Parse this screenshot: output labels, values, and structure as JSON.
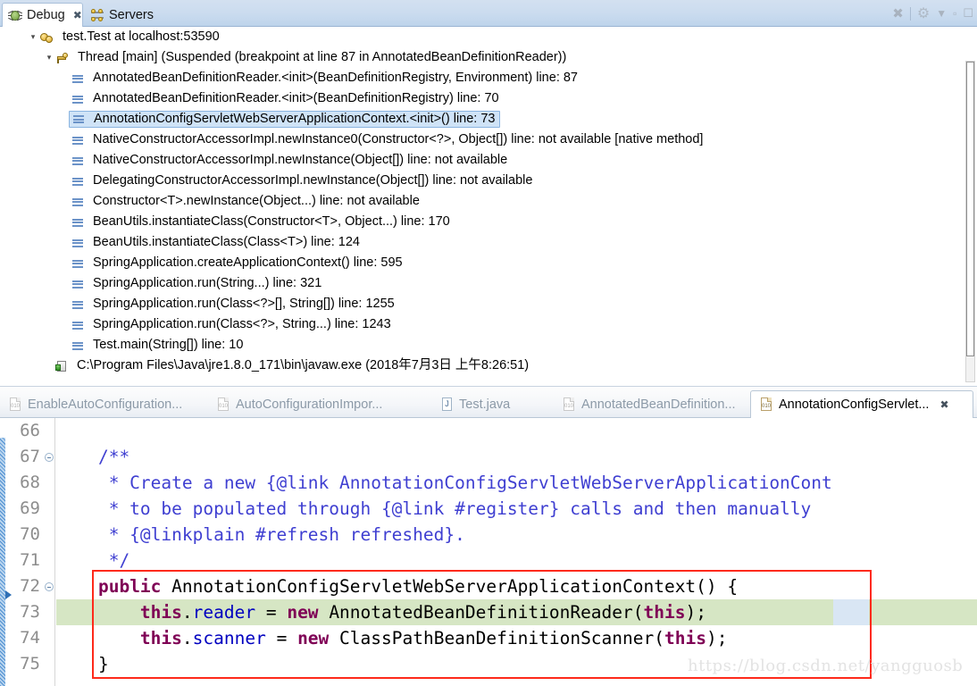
{
  "view_tabs": [
    {
      "label": "Debug",
      "icon": "bug-icon",
      "active": true,
      "closable": true
    },
    {
      "label": "Servers",
      "icon": "servers-icon",
      "active": false,
      "closable": false
    }
  ],
  "view_toolbar": [
    {
      "name": "remove-all-terminated-icon",
      "glyph": "✖"
    },
    {
      "name": "view-menu-gear-icon",
      "glyph": "⚙"
    },
    {
      "name": "minimize-view-icon",
      "glyph": "▽"
    },
    {
      "name": "maximize-view-icon",
      "glyph": "▭"
    },
    {
      "name": "restore-view-icon",
      "glyph": "□"
    }
  ],
  "debug_tree": [
    {
      "depth": 0,
      "icon": "debug-target-icon",
      "twisty": "▾",
      "selected": false,
      "label": "test.Test at localhost:53590"
    },
    {
      "depth": 1,
      "icon": "thread-icon",
      "twisty": "▾",
      "selected": false,
      "label": "Thread [main] (Suspended (breakpoint at line 87 in AnnotatedBeanDefinitionReader))"
    },
    {
      "depth": 2,
      "icon": "stack-frame-icon",
      "twisty": "",
      "selected": false,
      "label": "AnnotatedBeanDefinitionReader.<init>(BeanDefinitionRegistry, Environment) line: 87"
    },
    {
      "depth": 2,
      "icon": "stack-frame-icon",
      "twisty": "",
      "selected": false,
      "label": "AnnotatedBeanDefinitionReader.<init>(BeanDefinitionRegistry) line: 70"
    },
    {
      "depth": 2,
      "icon": "stack-frame-icon",
      "twisty": "",
      "selected": true,
      "label": "AnnotationConfigServletWebServerApplicationContext.<init>() line: 73"
    },
    {
      "depth": 2,
      "icon": "stack-frame-icon",
      "twisty": "",
      "selected": false,
      "label": "NativeConstructorAccessorImpl.newInstance0(Constructor<?>, Object[]) line: not available [native method]"
    },
    {
      "depth": 2,
      "icon": "stack-frame-icon",
      "twisty": "",
      "selected": false,
      "label": "NativeConstructorAccessorImpl.newInstance(Object[]) line: not available"
    },
    {
      "depth": 2,
      "icon": "stack-frame-icon",
      "twisty": "",
      "selected": false,
      "label": "DelegatingConstructorAccessorImpl.newInstance(Object[]) line: not available"
    },
    {
      "depth": 2,
      "icon": "stack-frame-icon",
      "twisty": "",
      "selected": false,
      "label": "Constructor<T>.newInstance(Object...) line: not available"
    },
    {
      "depth": 2,
      "icon": "stack-frame-icon",
      "twisty": "",
      "selected": false,
      "label": "BeanUtils.instantiateClass(Constructor<T>, Object...) line: 170"
    },
    {
      "depth": 2,
      "icon": "stack-frame-icon",
      "twisty": "",
      "selected": false,
      "label": "BeanUtils.instantiateClass(Class<T>) line: 124"
    },
    {
      "depth": 2,
      "icon": "stack-frame-icon",
      "twisty": "",
      "selected": false,
      "label": "SpringApplication.createApplicationContext() line: 595"
    },
    {
      "depth": 2,
      "icon": "stack-frame-icon",
      "twisty": "",
      "selected": false,
      "label": "SpringApplication.run(String...) line: 321"
    },
    {
      "depth": 2,
      "icon": "stack-frame-icon",
      "twisty": "",
      "selected": false,
      "label": "SpringApplication.run(Class<?>[], String[]) line: 1255"
    },
    {
      "depth": 2,
      "icon": "stack-frame-icon",
      "twisty": "",
      "selected": false,
      "label": "SpringApplication.run(Class<?>, String...) line: 1243"
    },
    {
      "depth": 2,
      "icon": "stack-frame-icon",
      "twisty": "",
      "selected": false,
      "label": "Test.main(String[]) line: 10"
    },
    {
      "depth": 1,
      "icon": "process-icon",
      "twisty": "",
      "selected": false,
      "label": "C:\\Program Files\\Java\\jre1.8.0_171\\bin\\javaw.exe (2018年7月3日 上午8:26:51)"
    }
  ],
  "editor_tabs": [
    {
      "label": "EnableAutoConfiguration...",
      "icon": "class-file-icon",
      "active": false,
      "closable": false
    },
    {
      "label": "AutoConfigurationImpor...",
      "icon": "class-file-icon",
      "active": false,
      "closable": false
    },
    {
      "label": "Test.java",
      "icon": "java-file-icon",
      "active": false,
      "closable": false
    },
    {
      "label": "AnnotatedBeanDefinition...",
      "icon": "class-file-icon",
      "active": false,
      "closable": false
    },
    {
      "label": "AnnotationConfigServlet...",
      "icon": "class-file-icon",
      "active": true,
      "closable": true
    }
  ],
  "editor": {
    "first_line": 66,
    "current_line": 73,
    "line_numbers": [
      "66",
      "67",
      "68",
      "69",
      "70",
      "71",
      "72",
      "73",
      "74",
      "75"
    ],
    "fold_lines": [
      "67",
      "72"
    ],
    "lines": [
      {
        "num": "66",
        "text": ""
      },
      {
        "num": "67",
        "text": "    /**"
      },
      {
        "num": "68",
        "text": "     * Create a new {@link AnnotationConfigServletWebServerApplicationCont"
      },
      {
        "num": "69",
        "text": "     * to be populated through {@link #register} calls and then manually"
      },
      {
        "num": "70",
        "text": "     * {@linkplain #refresh refreshed}."
      },
      {
        "num": "71",
        "text": "     */"
      },
      {
        "num": "72",
        "text": "    public AnnotationConfigServletWebServerApplicationContext() {"
      },
      {
        "num": "73",
        "text": "        this.reader = new AnnotatedBeanDefinitionReader(this);"
      },
      {
        "num": "74",
        "text": "        this.scanner = new ClassPathBeanDefinitionScanner(this);"
      },
      {
        "num": "75",
        "text": "    }"
      }
    ]
  },
  "watermark": "https://blog.csdn.net/yangguosb",
  "colors": {
    "tab_active_bg": "#ffffff",
    "view_tabbar_bg": "#cbdcef",
    "tree_selection_bg": "#cfe3f7",
    "tree_selection_border": "#8ab4e0",
    "current_line_bg": "#d6e6c4",
    "keyword": "#7f0055",
    "comment": "#3f3fd1",
    "field": "#0000c0",
    "annotation_box_border": "#fe2a1b",
    "change_bar": "#4d8fd1"
  }
}
